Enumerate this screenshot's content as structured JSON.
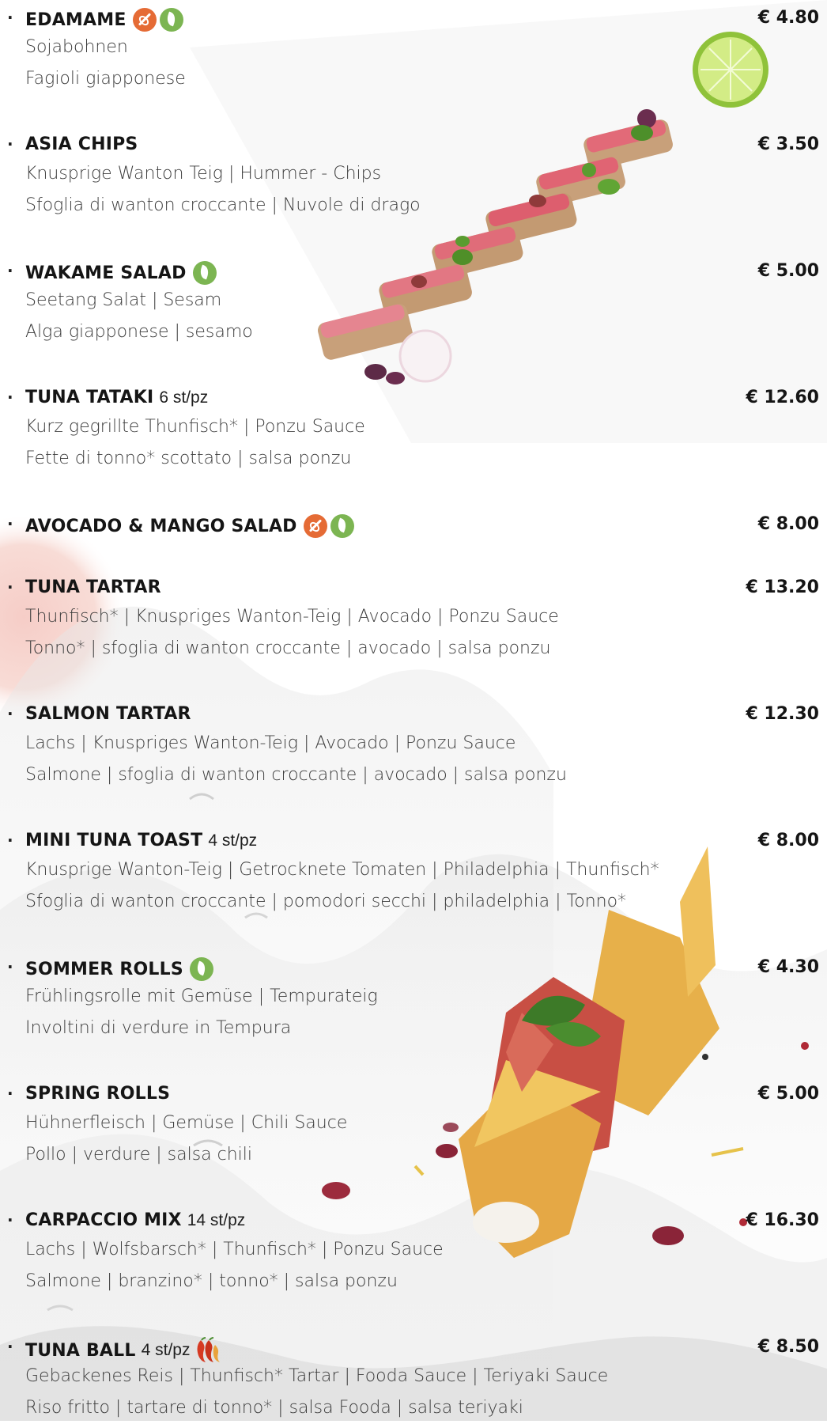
{
  "colors": {
    "text": "#151515",
    "description": "#3c3c3c",
    "vegan_icon": "#7cb552",
    "gluten_free_icon": "#e56b35",
    "chili_icon": "#d63a22",
    "background_sun": "#f4c8c4"
  },
  "items": [
    {
      "bullet": "·",
      "name": "EDAMAME",
      "qty": "",
      "price": "€ 4.80",
      "icons": [
        "gluten-free-icon",
        "vegan-leaf-icon"
      ],
      "desc": [
        "Sojabohnen",
        "Fagioli giapponese"
      ]
    },
    {
      "bullet": "·",
      "name": "ASIA CHIPS",
      "qty": "",
      "price": "€ 3.50",
      "icons": [],
      "desc": [
        "Knusprige Wanton Teig | Hummer - Chips",
        "Sfoglia di wanton croccante | Nuvole di drago"
      ]
    },
    {
      "bullet": "·",
      "name": "WAKAME SALAD",
      "qty": "",
      "price": "€ 5.00",
      "icons": [
        "vegan-leaf-icon"
      ],
      "desc": [
        "Seetang Salat | Sesam",
        "Alga giapponese | sesamo"
      ]
    },
    {
      "bullet": "·",
      "name": "TUNA TATAKI",
      "qty": "6 st/pz",
      "price": "€ 12.60",
      "icons": [],
      "desc": [
        "Kurz gegrillte Thunfisch*  | Ponzu Sauce",
        "Fette di tonno* scottato  | salsa ponzu"
      ]
    },
    {
      "bullet": "·",
      "name": "AVOCADO & MANGO SALAD",
      "qty": "",
      "price": "€ 8.00",
      "icons": [
        "gluten-free-icon",
        "vegan-leaf-icon"
      ],
      "desc": []
    },
    {
      "bullet": "·",
      "name": "TUNA TARTAR",
      "qty": "",
      "price": "€ 13.20",
      "icons": [],
      "desc": [
        "Thunfisch* | Knuspriges Wanton-Teig | Avocado | Ponzu Sauce",
        "Tonno* | sfoglia di wanton croccante | avocado | salsa ponzu"
      ]
    },
    {
      "bullet": "·",
      "name": "SALMON TARTAR",
      "qty": "",
      "price": "€ 12.30",
      "icons": [],
      "desc": [
        "Lachs | Knuspriges Wanton-Teig | Avocado | Ponzu Sauce",
        "Salmone | sfoglia di wanton croccante | avocado | salsa ponzu"
      ]
    },
    {
      "bullet": "·",
      "name": "MINI TUNA TOAST",
      "qty": "4 st/pz",
      "price": "€ 8.00",
      "icons": [],
      "desc": [
        "Knusprige Wanton-Teig | Getrocknete Tomaten | Philadelphia | Thunfisch*",
        "Sfoglia di wanton croccante | pomodori secchi | philadelphia | Tonno*"
      ]
    },
    {
      "bullet": "·",
      "name": "SOMMER ROLLS",
      "qty": "",
      "price": "€ 4.30",
      "icons": [
        "vegan-leaf-icon"
      ],
      "desc": [
        "Frühlingsrolle mit Gemüse | Tempurateig",
        "Involtini di verdure in Tempura"
      ]
    },
    {
      "bullet": "·",
      "name": "SPRING ROLLS",
      "qty": "",
      "price": "€ 5.00",
      "icons": [],
      "desc": [
        "Hühnerfleisch | Gemüse | Chili Sauce",
        "Pollo | verdure | salsa chili"
      ]
    },
    {
      "bullet": "·",
      "name": "CARPACCIO MIX",
      "qty": "14 st/pz",
      "price": "€ 16.30",
      "icons": [],
      "desc": [
        "Lachs | Wolfsbarsch* | Thunfisch* | Ponzu Sauce",
        "Salmone | branzino* | tonno* | salsa ponzu"
      ]
    },
    {
      "bullet": "·",
      "name": "TUNA BALL",
      "qty": "4 st/pz",
      "price": "€ 8.50",
      "icons": [
        "chili-pepper-icon"
      ],
      "desc": [
        "Gebackenes Reis | Thunfisch* Tartar | Fooda Sauce | Teriyaki Sauce",
        "Riso fritto | tartare di tonno* | salsa Fooda | salsa teriyaki"
      ]
    }
  ]
}
